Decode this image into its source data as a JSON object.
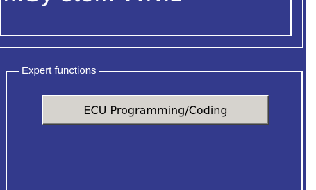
{
  "header": {
    "title_fragment": "...Sy stem vv.v.z"
  },
  "expert_group": {
    "label": "Expert functions",
    "button_label": "ECU Programming/Coding"
  },
  "colors": {
    "panel_background": "#333a8c",
    "frame_lines": "#ffffff",
    "button_face": "#d6d3ce"
  }
}
